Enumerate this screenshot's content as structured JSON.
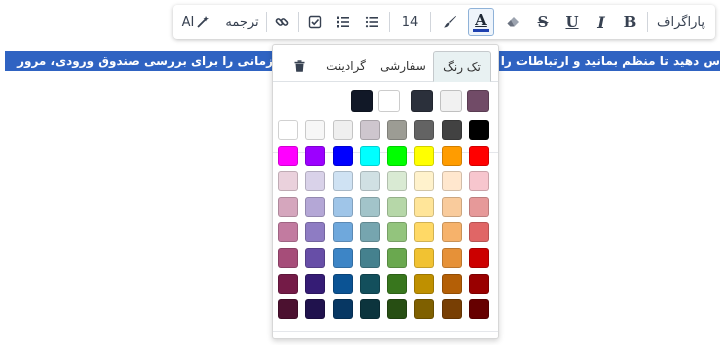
{
  "toolbar": {
    "paragraph_label": "پاراگراف",
    "font_size": "14",
    "translate_label": "ترجمه",
    "ai_label": "AI",
    "bold_glyph": "B",
    "italic_glyph": "I",
    "underline_glyph": "U",
    "strike_glyph": "S",
    "text_color_glyph": "A",
    "icons": [
      "bold-icon",
      "italic-icon",
      "underline-icon",
      "strikethrough-icon",
      "eraser-icon",
      "text-color-icon",
      "brush-icon",
      "bullet-list-icon",
      "numbered-list-icon",
      "checklist-icon",
      "link-icon",
      "magic-wand-icon"
    ]
  },
  "selected_text": {
    "left_part": "زمانی را برای بررسی صندوق ورودی، مرور",
    "right_part": "س دهید تا منظم بمانید و ارتباطات را حفظ کنید."
  },
  "color_popup": {
    "tabs": [
      {
        "label": "تک رنگ",
        "active": true
      },
      {
        "label": "سفارشی",
        "active": false
      },
      {
        "label": "گرادینت",
        "active": false
      }
    ],
    "trash_icon": "trash-icon",
    "theme_colors": [
      "#714b67",
      "#f1f1f1",
      "#2b303b",
      "#ffffff",
      "#111827"
    ],
    "palette": [
      [
        "#000000",
        "#424242",
        "#636363",
        "#9c9c94",
        "#cec6ce",
        "#efefef",
        "#f7f7f7",
        "#ffffff"
      ],
      [
        "#ff0000",
        "#ff9c00",
        "#ffff00",
        "#00ff00",
        "#00ffff",
        "#0000ff",
        "#9c00ff",
        "#ff00ff"
      ],
      [
        "#f7c6ce",
        "#ffe7ce",
        "#fff2cc",
        "#d9ead3",
        "#d0e0e3",
        "#cfe2f3",
        "#d9d2e9",
        "#ead1dc"
      ],
      [
        "#e69999",
        "#f9cb9c",
        "#ffe599",
        "#b6d7a8",
        "#a2c4c9",
        "#9fc5e8",
        "#b4a7d6",
        "#d5a6bd"
      ],
      [
        "#e06666",
        "#f6b26b",
        "#ffd966",
        "#93c47d",
        "#76a5af",
        "#6fa8dc",
        "#8e7cc3",
        "#c27ba0"
      ],
      [
        "#cc0000",
        "#e69138",
        "#f1c232",
        "#6aa84f",
        "#45818e",
        "#3d85c6",
        "#674ea7",
        "#a64d79"
      ],
      [
        "#990000",
        "#b45f06",
        "#bf9000",
        "#38761d",
        "#134f5c",
        "#0b5394",
        "#351c75",
        "#741b47"
      ],
      [
        "#660000",
        "#783f04",
        "#7f6000",
        "#274e13",
        "#0c343d",
        "#073763",
        "#20124d",
        "#4c1130"
      ]
    ]
  }
}
